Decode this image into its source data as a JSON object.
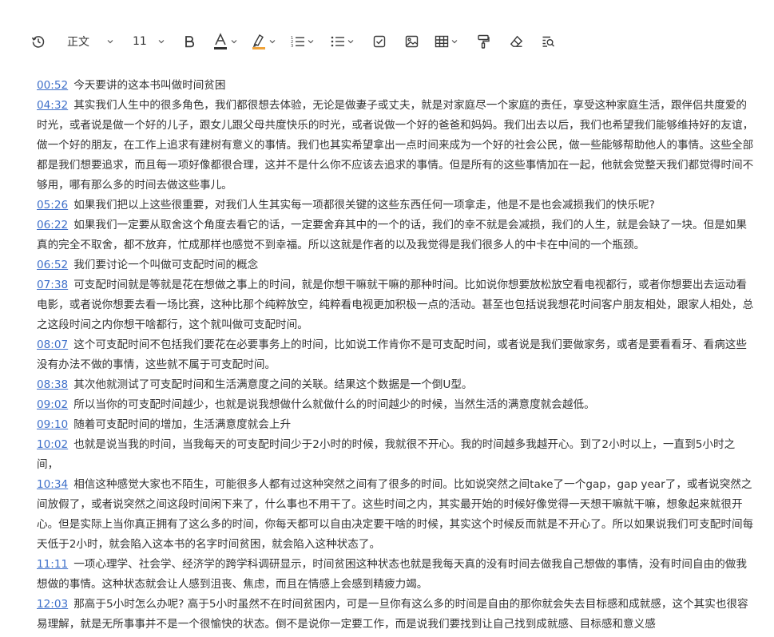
{
  "toolbar": {
    "style_label": "正文",
    "font_size": "11"
  },
  "transcript": [
    {
      "time": "00:52",
      "text": "今天要讲的这本书叫做时间贫困"
    },
    {
      "time": "04:32",
      "text": "其实我们人生中的很多角色，我们都很想去体验，无论是做妻子或丈夫，就是对家庭尽一个家庭的责任，享受这种家庭生活，跟伴侣共度爱的时光，或者说是做一个好的儿子，跟女儿跟父母共度快乐的时光，或者说做一个好的爸爸和妈妈。我们出去以后，我们也希望我们能够维持好的友谊，做一个好的朋友，在工作上追求有建树有意义的事情。我们也其实希望拿出一点时间来成为一个好的社会公民，做一些能够帮助他人的事情。这些全部都是我们想要追求，而且每一项好像都很合理，这并不是什么你不应该去追求的事情。但是所有的这些事情加在一起，他就会觉整天我们都觉得时间不够用，哪有那么多的时间去做这些事儿。"
    },
    {
      "time": "05:26",
      "text": "如果我们把以上这些很重要，对我们人生其实每一项都很关键的这些东西任何一项拿走，他是不是也会减损我们的快乐呢?"
    },
    {
      "time": "06:22",
      "text": "如果我们一定要从取舍这个角度去看它的话，一定要舍弃其中的一个的话，我们的幸不就是会减损，我们的人生，就是会缺了一块。但是如果真的完全不取舍，都不放弃，忙成那样也感觉不到幸福。所以这就是作者的以及我觉得是我们很多人的中卡在中间的一个瓶颈。"
    },
    {
      "time": "06:52",
      "text": "我们要讨论一个叫做可支配时间的概念"
    },
    {
      "time": "07:38",
      "text": "可支配时间就是等就是花在想做之事上的时间，就是你想干嘛就干嘛的那种时间。比如说你想要放松放空看电视都行，或者你想要出去运动看电影，或者说你想要去看一场比赛，这种比那个纯粹放空，纯粹看电视更加积极一点的活动。甚至也包括说我想花时间客户朋友相处，跟家人相处，总之这段时间之内你想干啥都行，这个就叫做可支配时间。"
    },
    {
      "time": "08:07",
      "text": "这个可支配时间不包括我们要花在必要事务上的时间，比如说工作肯你不是可支配时间，或者说是我们要做家务，或者是要看看牙、看病这些没有办法不做的事情，这些就不属于可支配时间。"
    },
    {
      "time": "08:38",
      "text": "其次他就测试了可支配时间和生活满意度之间的关联。结果这个数据是一个倒U型。"
    },
    {
      "time": "09:02",
      "text": "所以当你的可支配时间越少，也就是说我想做什么就做什么的时间越少的时候，当然生活的满意度就会越低。"
    },
    {
      "time": "09:10",
      "text": "随着可支配时间的增加，生活满意度就会上升"
    },
    {
      "time": "10:02",
      "text": "也就是说当我的时间，当我每天的可支配时间少于2小时的时候，我就很不开心。我的时间越多我越开心。到了2小时以上，一直到5小时之间，"
    },
    {
      "time": "10:34",
      "text": "相信这种感觉大家也不陌生，可能很多人都有过这种突然之间有了很多的时间。比如说突然之间take了一个gap，gap year了，或者说突然之间放假了，或者说突然之间这段时间闲下来了，什么事也不用干了。这些时间之内，其实最开始的时候好像觉得一天想干嘛就干嘛，想象起来就很开心。但是实际上当你真正拥有了这么多的时间，你每天都可以自由决定要干啥的时候，其实这个时候反而就是不开心了。所以如果说我们可支配时间每天低于2小时，就会陷入这本书的名字时间贫困，就会陷入这种状态了。"
    },
    {
      "time": "11:11",
      "text": "一项心理学、社会学、经济学的跨学科调研显示，时间贫困这种状态也就是我每天真的没有时间去做我自己想做的事情，没有时间自由的做我想做的事情。这种状态就会让人感到沮丧、焦虑，而且在情感上会感到精疲力竭。"
    },
    {
      "time": "12:03",
      "text": "那高于5小时怎么办呢? 高于5小时虽然不在时间贫困内，可是一旦你有这么多的时间是自由的那你就会失去目标感和成就感，这个其实也很容易理解，就是无所事事并不是一个很愉快的状态。倒不是说你一定要工作，而是说我们要找到让自己找到成就感、目标感和意义感"
    }
  ]
}
